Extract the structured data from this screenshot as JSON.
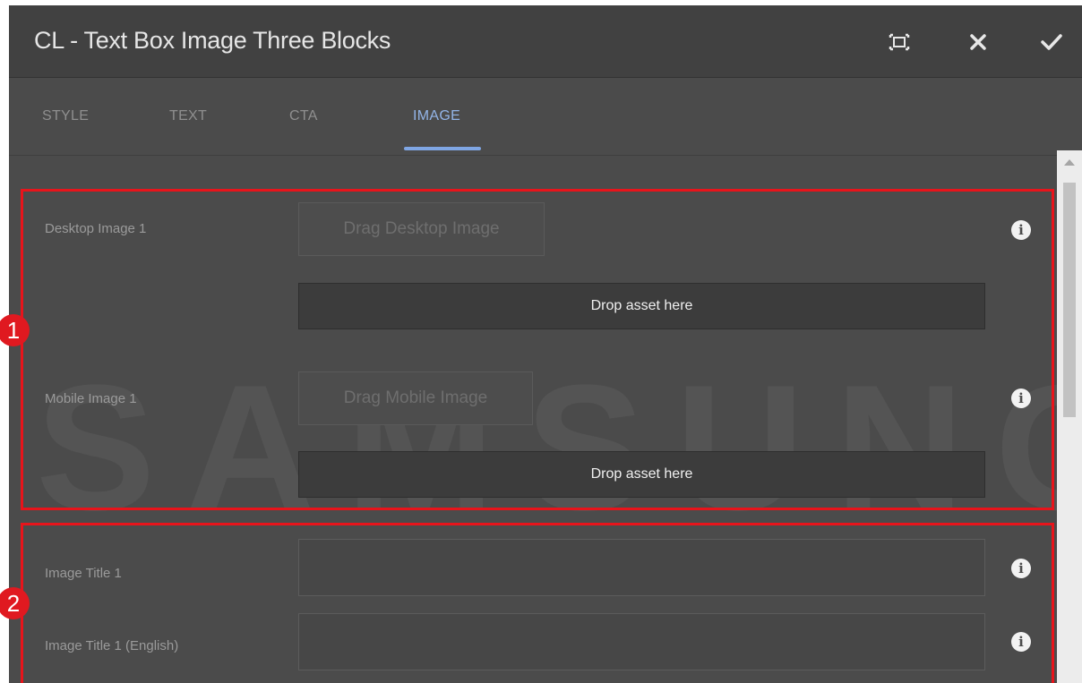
{
  "dialog": {
    "title": "CL - Text Box Image Three Blocks",
    "actions": [
      {
        "name": "fullscreen-icon"
      },
      {
        "name": "close-icon"
      },
      {
        "name": "check-icon"
      }
    ]
  },
  "tabs": [
    {
      "label": "STYLE",
      "active": false
    },
    {
      "label": "TEXT",
      "active": false
    },
    {
      "label": "CTA",
      "active": false
    },
    {
      "label": "IMAGE",
      "active": true
    }
  ],
  "watermark": "SAMSUNG",
  "image_section": {
    "desktop": {
      "label": "Desktop Image 1",
      "button_label": "Drag Desktop Image",
      "drop_label": "Drop asset here"
    },
    "mobile": {
      "label": "Mobile Image 1",
      "button_label": "Drag Mobile Image",
      "drop_label": "Drop asset here"
    }
  },
  "title_section": {
    "image_title": {
      "label": "Image Title 1",
      "value": ""
    },
    "image_title_english": {
      "label": "Image Title 1 (English)",
      "value": ""
    }
  },
  "annotations": {
    "badge_1": "1",
    "badge_2": "2",
    "highlight_color": "#e8141b"
  },
  "colors": {
    "accent": "#7fa6e4",
    "panel": "#4b4b4b",
    "titlebar": "#414141"
  }
}
